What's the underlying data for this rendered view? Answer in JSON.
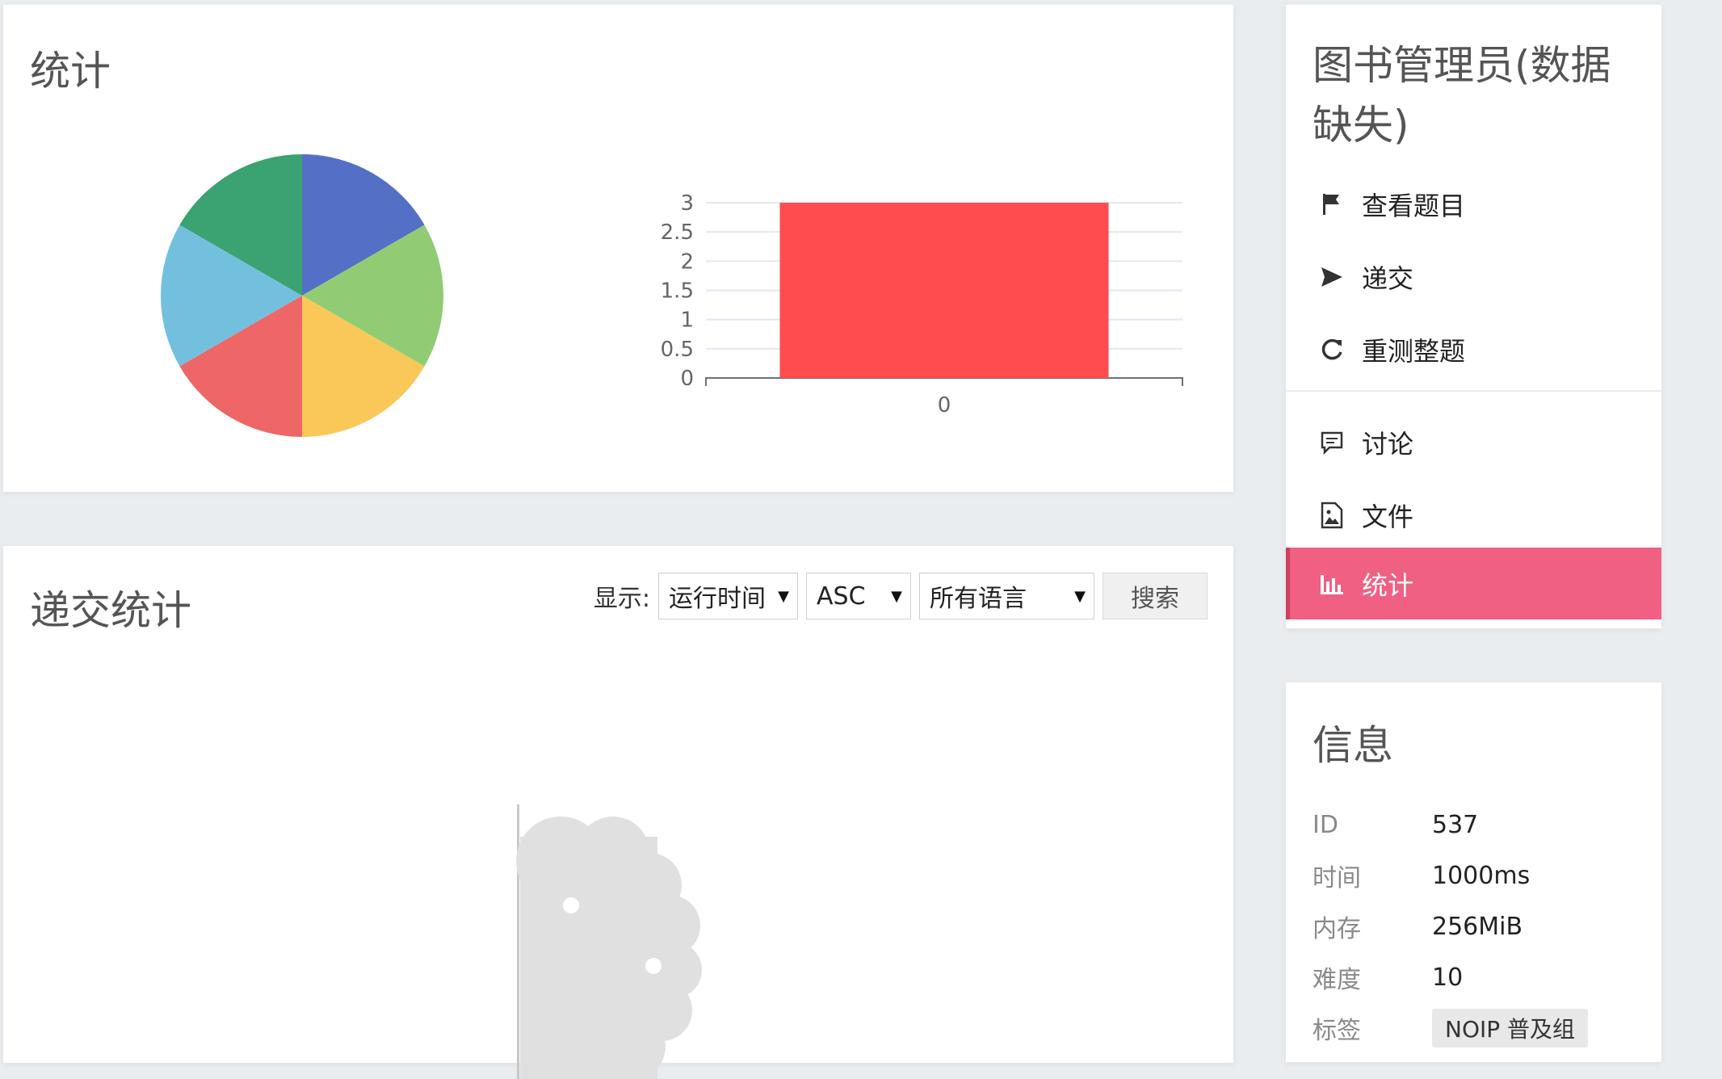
{
  "stats": {
    "title": "统计"
  },
  "chart_data": [
    {
      "type": "pie",
      "values": [
        1,
        1,
        1,
        1,
        1,
        1
      ],
      "colors": [
        "#5470c6",
        "#91cc75",
        "#fac858",
        "#ee6666",
        "#73c0de",
        "#3ba272"
      ]
    },
    {
      "type": "bar",
      "categories": [
        "0"
      ],
      "values": [
        3
      ],
      "ylim": [
        0,
        3
      ],
      "yticks": [
        "0",
        "0.5",
        "1",
        "1.5",
        "2",
        "2.5",
        "3"
      ],
      "color": "#ff4d4f",
      "grid": true
    }
  ],
  "submissions": {
    "title": "递交统计",
    "show_label": "显示:",
    "sort_value": "运行时间",
    "order_value": "ASC",
    "language_value": "所有语言",
    "search_label": "搜索"
  },
  "sidebar": {
    "title": "图书管理员(数据缺失)",
    "items": [
      {
        "label": "查看题目",
        "icon": "flag-icon"
      },
      {
        "label": "递交",
        "icon": "send-icon"
      },
      {
        "label": "重测整题",
        "icon": "refresh-icon"
      },
      {
        "label": "讨论",
        "icon": "comment-icon"
      },
      {
        "label": "文件",
        "icon": "file-image-icon"
      },
      {
        "label": "统计",
        "icon": "bar-chart-icon",
        "active": true
      }
    ],
    "active_color": "#ef6083"
  },
  "info": {
    "title": "信息",
    "rows": [
      {
        "key": "ID",
        "value": "537"
      },
      {
        "key": "时间",
        "value": "1000ms"
      },
      {
        "key": "内存",
        "value": "256MiB"
      },
      {
        "key": "难度",
        "value": "10"
      },
      {
        "key": "标签",
        "value": "NOIP 普及组"
      }
    ]
  }
}
